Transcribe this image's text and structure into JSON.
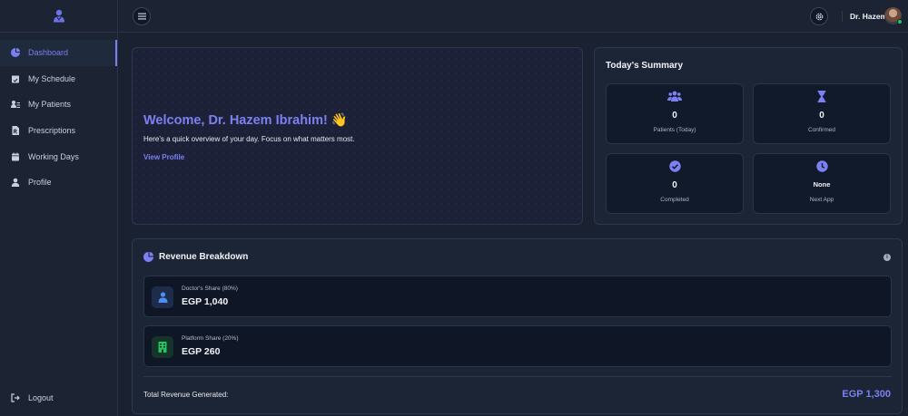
{
  "sidebar": {
    "items": [
      {
        "label": "Dashboard",
        "icon": "pie-chart-icon",
        "active": true
      },
      {
        "label": "My Schedule",
        "icon": "calendar-check-icon"
      },
      {
        "label": "My Patients",
        "icon": "user-list-icon"
      },
      {
        "label": "Prescriptions",
        "icon": "file-prescription-icon"
      },
      {
        "label": "Working Days",
        "icon": "calendar-icon"
      },
      {
        "label": "Profile",
        "icon": "user-icon"
      }
    ],
    "logout_label": "Logout"
  },
  "topbar": {
    "user_name": "Dr. Hazem"
  },
  "welcome": {
    "title": "Welcome, Dr. Hazem Ibrahim! 👋",
    "subtitle": "Here's a quick overview of your day. Focus on what matters most.",
    "link": "View Profile"
  },
  "summary": {
    "title": "Today's Summary",
    "stats": [
      {
        "value": "0",
        "label": "Patients (Today)",
        "icon": "users-icon"
      },
      {
        "value": "0",
        "label": "Confirmed",
        "icon": "hourglass-icon"
      },
      {
        "value": "0",
        "label": "Completed",
        "icon": "check-circle-icon"
      },
      {
        "value": "None",
        "label": "Next App",
        "icon": "clock-icon"
      }
    ]
  },
  "revenue": {
    "title": "Revenue Breakdown",
    "doctor_share_label": "Doctor's Share (80%)",
    "doctor_share_value": "EGP 1,040",
    "platform_share_label": "Platform Share (20%)",
    "platform_share_value": "EGP 260",
    "total_label": "Total Revenue Generated:",
    "total_value": "EGP 1,300"
  },
  "colors": {
    "accent": "#7c80f2",
    "background": "#1a2232",
    "card": "#1c2536",
    "success": "#22c55e"
  }
}
